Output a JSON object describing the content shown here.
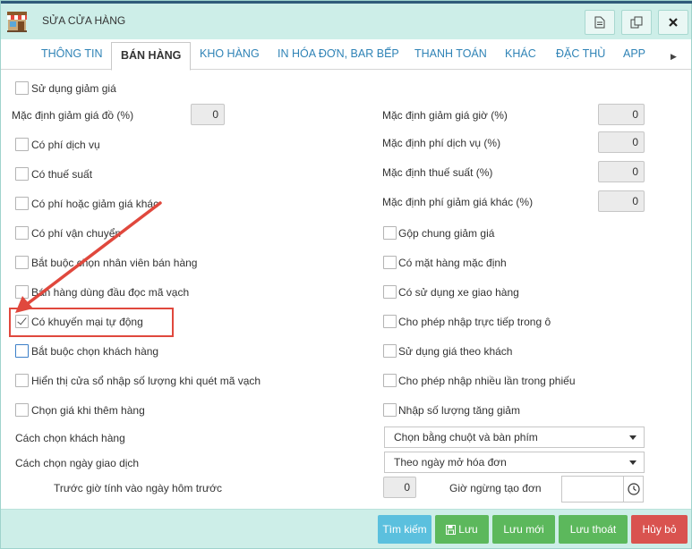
{
  "window": {
    "title": "SỬA CỬA HÀNG"
  },
  "tabs": [
    {
      "label": "THÔNG TIN",
      "active": false
    },
    {
      "label": "BÁN HÀNG",
      "active": true
    },
    {
      "label": "KHO HÀNG",
      "active": false
    },
    {
      "label": "IN HÓA ĐƠN, BAR BẾP",
      "active": false
    },
    {
      "label": "THANH TOÁN",
      "active": false
    },
    {
      "label": "KHÁC",
      "active": false
    },
    {
      "label": "ĐẶC THÙ",
      "active": false
    },
    {
      "label": "APP",
      "active": false
    }
  ],
  "form": {
    "use_discount": {
      "label": "Sử dụng giảm giá",
      "checked": false
    },
    "default_item_discount": {
      "label": "Mặc định giảm giá đồ (%)",
      "value": "0"
    },
    "left_options": [
      {
        "label": "Có phí dịch vụ",
        "checked": false
      },
      {
        "label": "Có thuế suất",
        "checked": false
      },
      {
        "label": "Có phí hoặc giảm giá khác",
        "checked": false
      },
      {
        "label": "Có phí vận chuyển",
        "checked": false
      },
      {
        "label": "Bắt buộc chọn nhân viên bán hàng",
        "checked": false
      },
      {
        "label": "Bán hàng dùng đầu đọc mã vạch",
        "checked": false
      },
      {
        "label": "Có khuyến mại tự động",
        "checked": true
      },
      {
        "label": "Bắt buộc chọn khách hàng",
        "checked": false
      },
      {
        "label": "Hiển thị cửa sổ nhập số lượng khi quét mã vạch",
        "checked": false
      },
      {
        "label": "Chọn giá khi thêm hàng",
        "checked": false
      }
    ],
    "right_numbers": [
      {
        "label": "Mặc định giảm giá giờ (%)",
        "value": "0"
      },
      {
        "label": "Mặc định phí dịch vụ (%)",
        "value": "0"
      },
      {
        "label": "Mặc định thuế suất (%)",
        "value": "0"
      },
      {
        "label": "Mặc định phí giảm giá khác (%)",
        "value": "0"
      }
    ],
    "right_options": [
      {
        "label": "Gộp chung giảm giá",
        "checked": false
      },
      {
        "label": "Có mặt hàng mặc định",
        "checked": false
      },
      {
        "label": "Có sử dụng xe giao hàng",
        "checked": false
      },
      {
        "label": "Cho phép nhập trực tiếp trong ô",
        "checked": false
      },
      {
        "label": "Sử dụng giá theo khách",
        "checked": false
      },
      {
        "label": "Cho phép nhập nhiều lần trong phiếu",
        "checked": false
      },
      {
        "label": "Nhập số lượng tăng giảm",
        "checked": false
      }
    ],
    "customer_select": {
      "label": "Cách chọn khách hàng",
      "value": "Chọn bằng chuột và bàn phím"
    },
    "date_select": {
      "label": "Cách chọn ngày giao dịch",
      "value": "Theo ngày mở hóa đơn"
    },
    "hours_before": {
      "label": "Trước giờ tính vào ngày hôm trước",
      "value": "0"
    },
    "stop_time": {
      "label": "Giờ ngừng tạo đơn",
      "value": ""
    }
  },
  "footer": {
    "search": "Tìm kiếm",
    "save": "Lưu",
    "save_new": "Lưu mới",
    "save_exit": "Lưu thoát",
    "cancel": "Hủy bỏ"
  },
  "colors": {
    "accent": "#cdeee8",
    "tab_link": "#2f83b6",
    "highlight": "#e0483d",
    "btn_search": "#5bc0de",
    "btn_green": "#5cb85c",
    "btn_red": "#d9534f"
  }
}
